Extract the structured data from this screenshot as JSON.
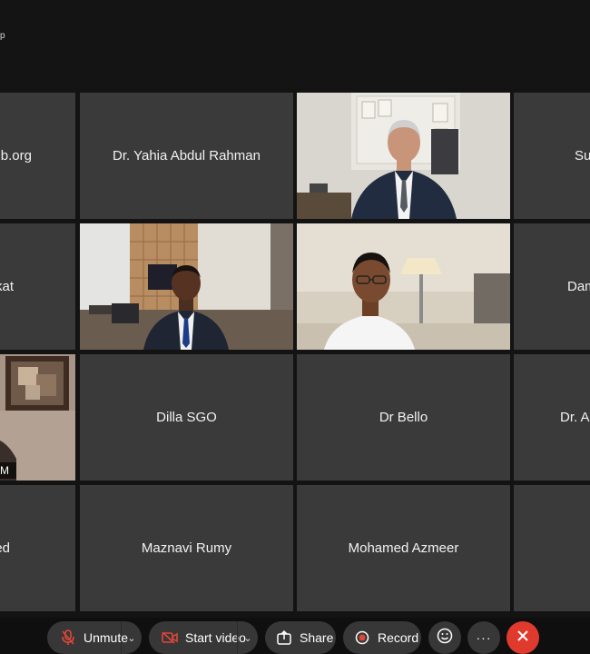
{
  "window": {
    "title_fragment": "p"
  },
  "participants": [
    {
      "name": "b.org",
      "video": false
    },
    {
      "name": "Dr. Yahia Abdul Rahman",
      "video": false
    },
    {
      "name": "",
      "video": true,
      "scene": "office-man-1"
    },
    {
      "name": "Su",
      "video": false
    },
    {
      "name": "kat",
      "video": false
    },
    {
      "name": "",
      "video": true,
      "scene": "office-man-2"
    },
    {
      "name": "",
      "video": true,
      "scene": "office-man-3"
    },
    {
      "name": "Dam",
      "video": false
    },
    {
      "name": "M",
      "video": true,
      "scene": "self-view",
      "active": true
    },
    {
      "name": "Dilla SGO",
      "video": false
    },
    {
      "name": "Dr Bello",
      "video": false
    },
    {
      "name": "Dr. A",
      "video": false
    },
    {
      "name": "ed",
      "video": false
    },
    {
      "name": "Maznavi Rumy",
      "video": false
    },
    {
      "name": "Mohamed Azmeer",
      "video": false
    },
    {
      "name": "",
      "video": false
    }
  ],
  "controls": {
    "unmute": "Unmute",
    "start_video": "Start video",
    "share": "Share",
    "record": "Record",
    "more": "···",
    "leave_icon": "close-icon"
  },
  "colors": {
    "tile": "#3a3a3a",
    "active_border": "#2fb6e6",
    "leave": "#e03a2e",
    "mute_icon": "#e0463a",
    "record_dot": "#e0463a"
  }
}
